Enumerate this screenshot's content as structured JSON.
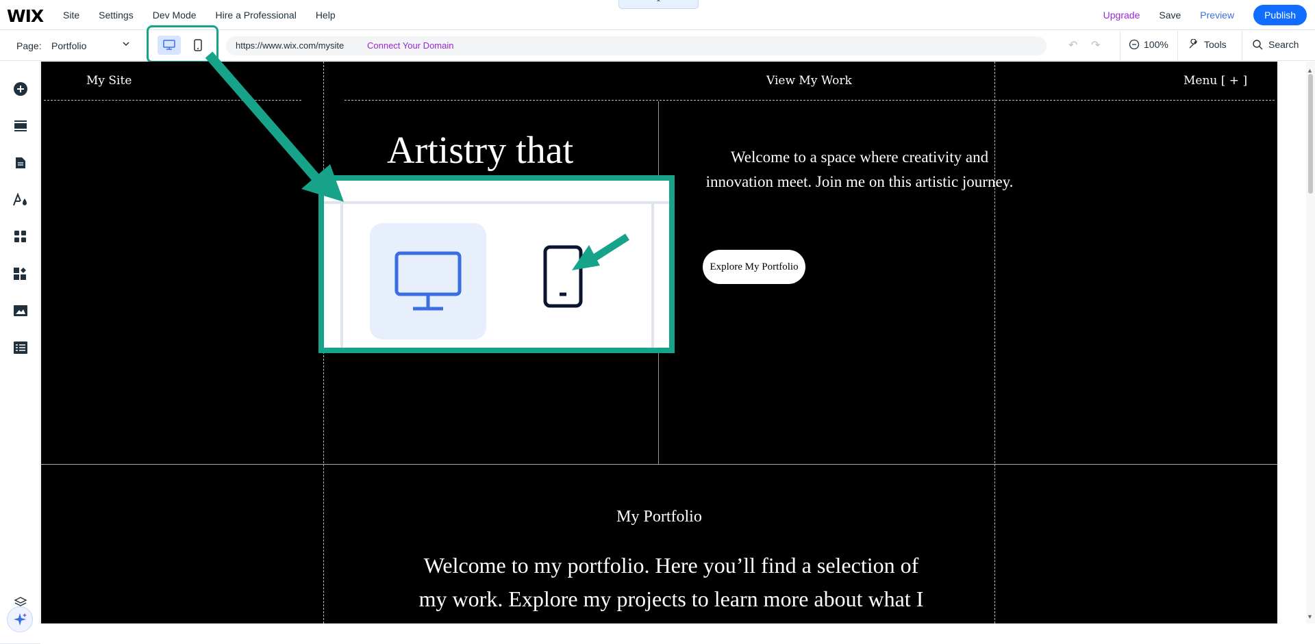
{
  "topbar": {
    "logo": "WIX",
    "menu": [
      "Site",
      "Settings",
      "Dev Mode",
      "Hire a Professional",
      "Help"
    ],
    "collapse_glyph": "⌃",
    "upgrade": "Upgrade",
    "save": "Save",
    "preview": "Preview",
    "publish": "Publish"
  },
  "secondbar": {
    "page_label": "Page:",
    "page_value": "Portfolio",
    "url": "https://www.wix.com/mysite",
    "connect_domain": "Connect Your Domain",
    "zoom": "100%",
    "tools": "Tools",
    "search": "Search"
  },
  "sidebar": {
    "icons": [
      "add-icon",
      "sections-icon",
      "pages-icon",
      "design-icon",
      "apps-icon",
      "business-icon",
      "media-icon",
      "cms-icon",
      "ai-assistant-icon",
      "layers-icon"
    ]
  },
  "site": {
    "nav": {
      "site_name": "My Site",
      "view_work": "View My Work",
      "menu": "Menu [ + ]"
    },
    "hero": {
      "title": "Artistry that",
      "text": "Welcome to a space where creativity and innovation meet. Join me on this artistic journey.",
      "cta": "Explore My Portfolio"
    },
    "portfolio": {
      "title": "My Portfolio",
      "text": "Welcome to my portfolio. Here you’ll find a selection of my work. Explore my projects to learn more about what I do."
    }
  },
  "colors": {
    "accent": "#17a389",
    "publish": "#116dff",
    "upgrade": "#9a27d5",
    "desktop_icon": "#3b6fe0"
  }
}
